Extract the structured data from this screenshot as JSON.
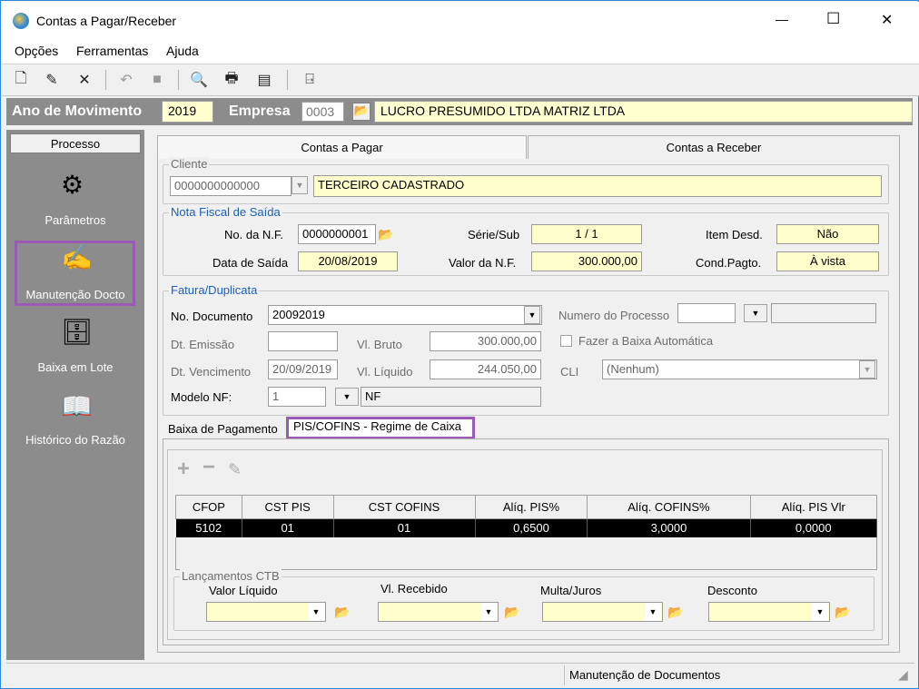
{
  "window": {
    "title": "Contas a Pagar/Receber",
    "minimize": "—",
    "maximize": "☐",
    "close": "✕"
  },
  "menu": {
    "items": [
      "Opções",
      "Ferramentas",
      "Ajuda"
    ]
  },
  "toolbar": {
    "icons": [
      "new-icon",
      "edit-icon",
      "delete-icon",
      "undo-icon",
      "stop-icon",
      "preview-icon",
      "print-icon",
      "report-icon",
      "exit-icon"
    ]
  },
  "header": {
    "ano_label": "Ano de Movimento",
    "ano_value": "2019",
    "empresa_label": "Empresa",
    "empresa_code": "0003",
    "empresa_name": "LUCRO PRESUMIDO LTDA MATRIZ LTDA"
  },
  "sidebar": {
    "head": "Processo",
    "items": [
      {
        "label": "Parâmetros",
        "icon": "gear-icon"
      },
      {
        "label": "Manutenção Docto",
        "icon": "document-edit-icon"
      },
      {
        "label": "Baixa em Lote",
        "icon": "batch-icon"
      },
      {
        "label": "Histórico do Razão",
        "icon": "book-icon"
      }
    ]
  },
  "tabs": {
    "pagar": "Contas a Pagar",
    "receber": "Contas a Receber"
  },
  "cliente": {
    "group": "Cliente",
    "code": "0000000000000",
    "name": "TERCEIRO CADASTRADO"
  },
  "nota": {
    "group": "Nota Fiscal de Saída",
    "no_label": "No. da N.F.",
    "no_value": "0000000001",
    "serie_label": "Série/Sub",
    "serie_value": "1 / 1",
    "item_label": "Item Desd.",
    "item_value": "Não",
    "data_label": "Data de Saída",
    "data_value": "20/08/2019",
    "valor_label": "Valor da N.F.",
    "valor_value": "300.000,00",
    "cond_label": "Cond.Pagto.",
    "cond_value": "À vista"
  },
  "fatura": {
    "group": "Fatura/Duplicata",
    "nodoc_label": "No. Documento",
    "nodoc_value": "20092019",
    "numproc_label": "Numero do Processo",
    "emissao_label": "Dt. Emissão",
    "emissao_value": "",
    "bruto_label": "Vl. Bruto",
    "bruto_value": "300.000,00",
    "baixa_label": "Fazer a Baixa Automática",
    "venc_label": "Dt. Vencimento",
    "venc_value": "20/09/2019",
    "liquido_label": "Vl. Líquido",
    "liquido_value": "244.050,00",
    "cli_label": "CLI",
    "cli_value": "(Nenhum)",
    "modelo_label": "Modelo NF:",
    "modelo_value": "1",
    "modelo_desc": "NF"
  },
  "subtabs": {
    "baixa": "Baixa de Pagamento",
    "pis": "PIS/COFINS - Regime de Caixa"
  },
  "grid": {
    "columns": [
      "CFOP",
      "CST PIS",
      "CST COFINS",
      "Alíq. PIS%",
      "Alíq. COFINS%",
      "Alíq. PIS Vlr"
    ],
    "rows": [
      [
        "5102",
        "01",
        "01",
        "0,6500",
        "3,0000",
        "0,0000"
      ]
    ]
  },
  "lanc": {
    "group": "Lançamentos CTB",
    "valor_liquido": "Valor Líquido",
    "vl_recebido": "Vl. Recebido",
    "multa": "Multa/Juros",
    "desconto": "Desconto"
  },
  "status": {
    "text": "Manutenção de Documentos"
  },
  "colors": {
    "highlight": "#9b59b6",
    "sidebar": "#8c8c8c",
    "yellow_field": "#ffffcc",
    "group_label": "#1c5fb5"
  }
}
